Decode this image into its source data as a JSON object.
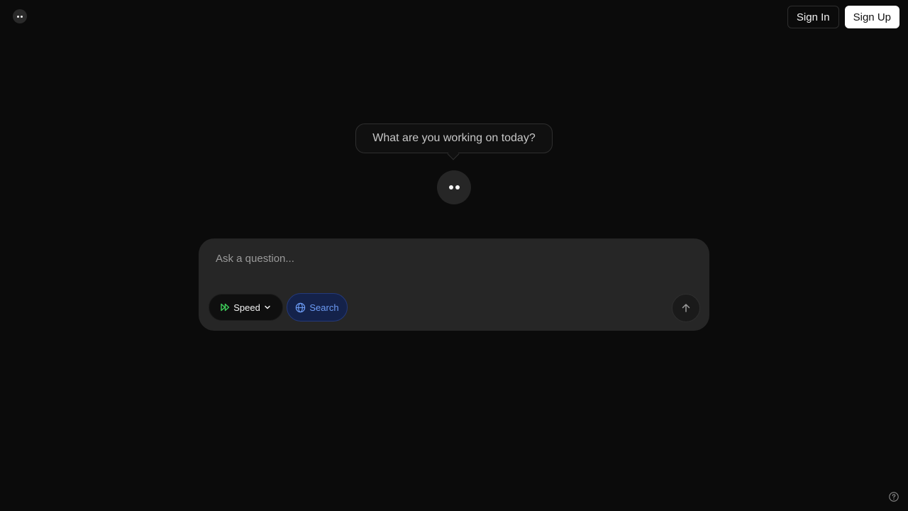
{
  "header": {
    "sign_in_label": "Sign In",
    "sign_up_label": "Sign Up"
  },
  "greeting": {
    "text": "What are you working on today?"
  },
  "composer": {
    "placeholder": "Ask a question...",
    "value": "",
    "mode_label": "Speed",
    "search_label": "Search"
  },
  "icons": {
    "logo": "logo-icon",
    "avatar": "assistant-avatar-icon",
    "mode": "fast-forward-icon",
    "mode_caret": "chevron-down-icon",
    "search": "globe-icon",
    "send": "arrow-up-icon",
    "help": "help-circle-icon"
  },
  "colors": {
    "background": "#0b0b0b",
    "composer": "#262626",
    "speed_icon": "#3ecf5a",
    "search_text": "#6d9cf5",
    "search_bg": "#14224a",
    "primary_button": "#ffffff"
  }
}
